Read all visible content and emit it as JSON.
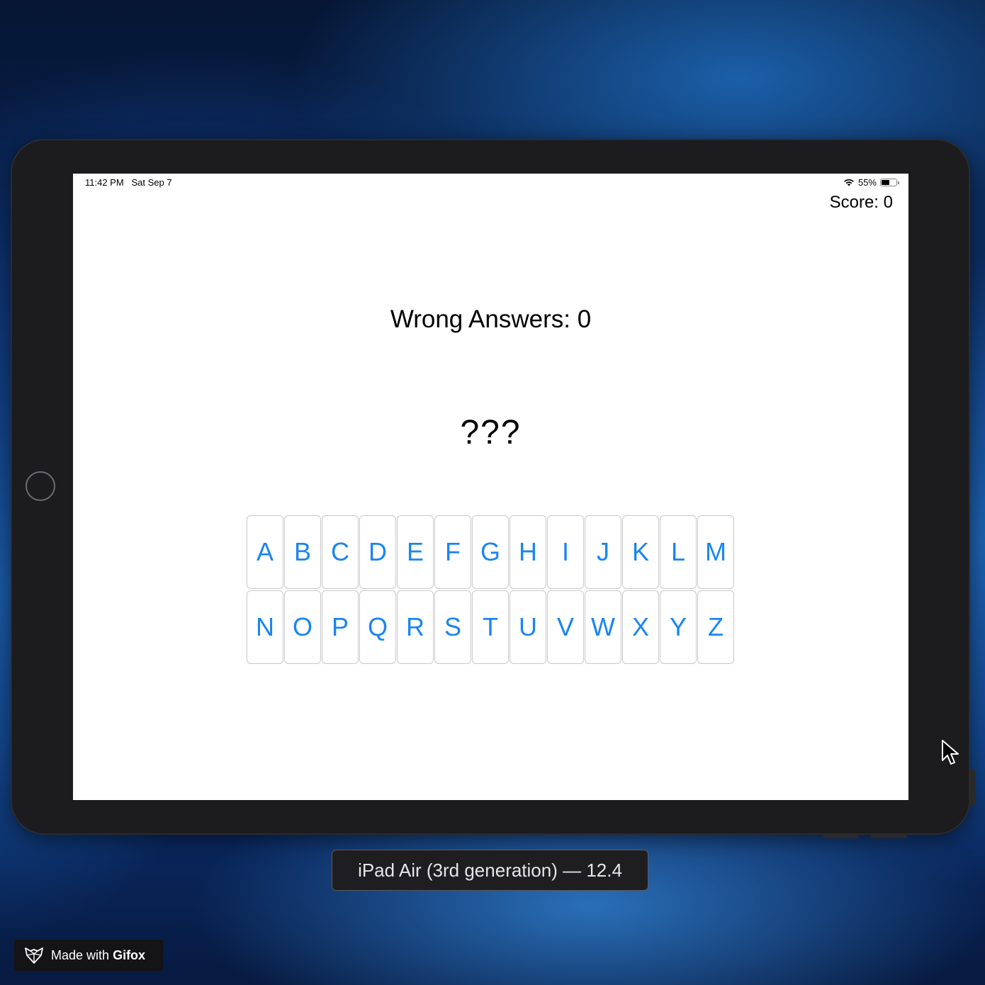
{
  "status_bar": {
    "time": "11:42 PM   Sat Sep 7",
    "battery": "55%",
    "battery_level": 0.55
  },
  "game": {
    "score": "Score: 0",
    "wrong_answers": "Wrong Answers: 0",
    "word": "???",
    "letters": [
      "A",
      "B",
      "C",
      "D",
      "E",
      "F",
      "G",
      "H",
      "I",
      "J",
      "K",
      "L",
      "M",
      "N",
      "O",
      "P",
      "Q",
      "R",
      "S",
      "T",
      "U",
      "V",
      "W",
      "X",
      "Y",
      "Z"
    ]
  },
  "simulator": {
    "device_label": "iPad Air (3rd generation) — 12.4"
  },
  "watermark": {
    "prefix": "Made with",
    "brand": "Gifox"
  },
  "colors": {
    "key_text": "#1a85f0",
    "bezel": "#1c1c1e"
  },
  "icons": [
    "wifi-icon",
    "battery-icon",
    "gifox-logo-icon",
    "mouse-cursor-icon",
    "home-button"
  ]
}
